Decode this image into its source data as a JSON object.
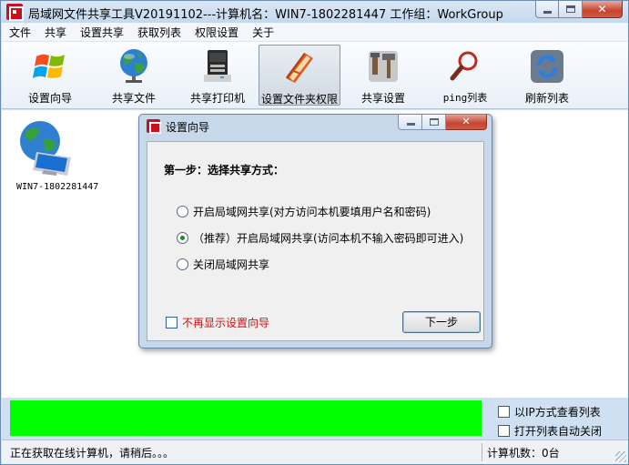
{
  "window": {
    "title": "局域网文件共享工具V20191102---计算机名：WIN7-1802281447  工作组：WorkGroup",
    "buttons": {
      "minimize": "minimize",
      "maximize": "maximize",
      "close": "✕"
    }
  },
  "menu": [
    "文件",
    "共享",
    "设置共享",
    "获取列表",
    "权限设置",
    "关于"
  ],
  "toolbar": [
    {
      "label": "设置向导",
      "icon": "windows-logo-icon"
    },
    {
      "label": "共享文件",
      "icon": "globe-icon"
    },
    {
      "label": "共享打印机",
      "icon": "printer-icon"
    },
    {
      "label": "设置文件夹权限",
      "icon": "folder-book-icon"
    },
    {
      "label": "共享设置",
      "icon": "tools-icon"
    },
    {
      "label": "ping列表",
      "icon": "magnifier-icon"
    },
    {
      "label": "刷新列表",
      "icon": "refresh-icon"
    }
  ],
  "computers": [
    {
      "name": "WIN7-1802281447",
      "icon": "network-computer-icon"
    }
  ],
  "options": {
    "ip_view": "以IP方式查看列表",
    "auto_close": "打开列表自动关闭"
  },
  "status": {
    "left": "正在获取在线计算机，请稍后。。。",
    "right": "计算机数：0台"
  },
  "dialog": {
    "title": "设置向导",
    "step": "第一步：选择共享方式：",
    "radios": [
      {
        "label": "开启局域网共享(对方访问本机要填用户名和密码)",
        "selected": false
      },
      {
        "label": "（推荐）开启局域网共享(访问本机不输入密码即可进入)",
        "selected": true
      },
      {
        "label": "关闭局域网共享",
        "selected": false
      }
    ],
    "dont_show": "不再显示设置向导",
    "next_button": "下一步"
  },
  "colors": {
    "progress": "#00ff00",
    "warning_text": "#d01010",
    "titlebar": "#c4d8ee"
  }
}
